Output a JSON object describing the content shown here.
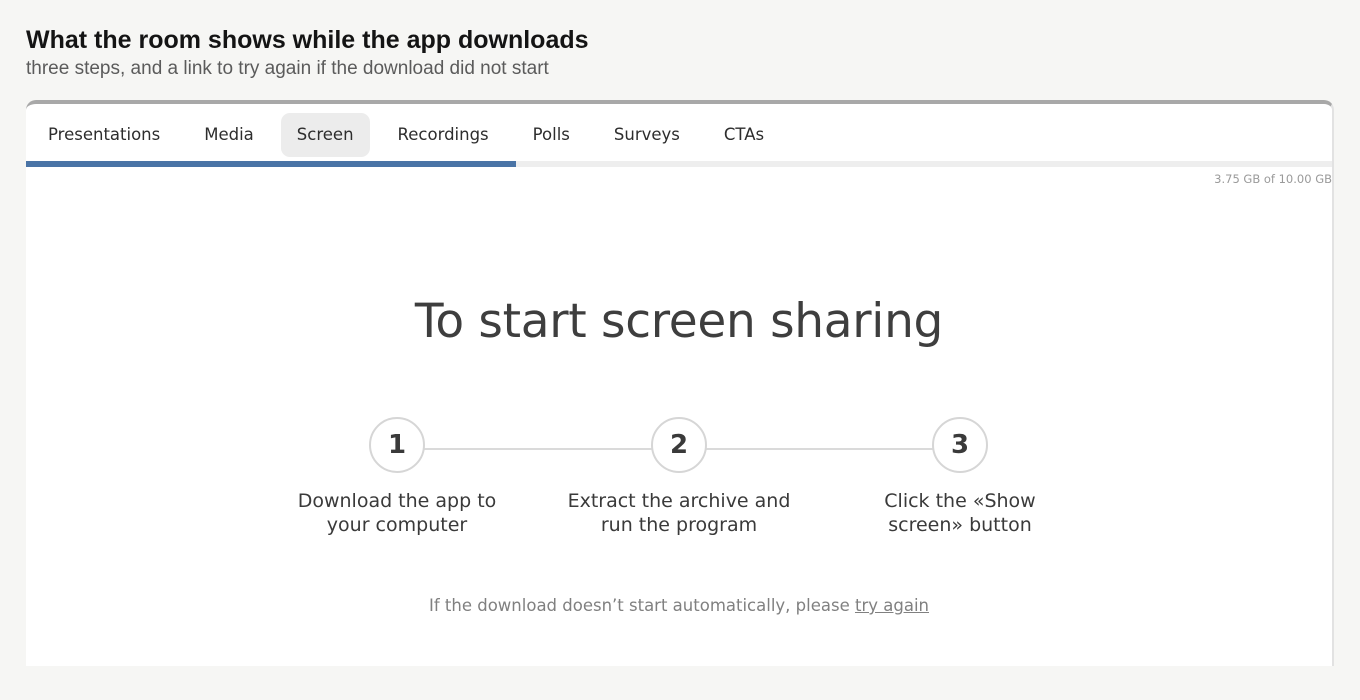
{
  "header": {
    "title": "What the room shows while the app downloads",
    "subtitle": "three steps, and a link to try again if the download did not start"
  },
  "tabs": [
    {
      "label": "Presentations",
      "active": false
    },
    {
      "label": "Media",
      "active": false
    },
    {
      "label": "Screen",
      "active": true
    },
    {
      "label": "Recordings",
      "active": false
    },
    {
      "label": "Polls",
      "active": false
    },
    {
      "label": "Surveys",
      "active": false
    },
    {
      "label": "CTAs",
      "active": false
    }
  ],
  "storage": {
    "label": "3.75 GB of 10.00 GB",
    "used_fraction": 0.375
  },
  "main": {
    "heading": "To start screen sharing"
  },
  "steps": [
    {
      "number": "1",
      "text_line1": "Download the app to",
      "text_line2": "your computer"
    },
    {
      "number": "2",
      "text_line1": "Extract the archive and",
      "text_line2": "run the program"
    },
    {
      "number": "3",
      "text_line1": "Click the «Show",
      "text_line2": "screen» button"
    }
  ],
  "retry": {
    "prefix": "If the download doesn’t start automatically, please ",
    "link_label": "try again"
  },
  "colors": {
    "accent": "#4a74a6",
    "page_background": "#f6f6f4"
  }
}
